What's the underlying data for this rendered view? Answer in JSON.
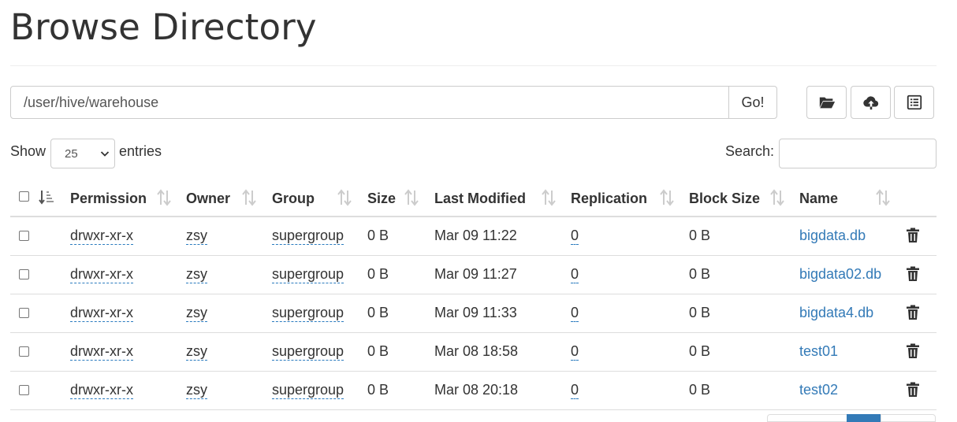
{
  "page": {
    "title": "Browse Directory"
  },
  "path_bar": {
    "value": "/user/hive/warehouse",
    "go_label": "Go!"
  },
  "toolbar": {
    "buttons": [
      {
        "icon": "folder-open-icon",
        "label": ""
      },
      {
        "icon": "cloud-upload-icon",
        "label": ""
      },
      {
        "icon": "list-alt-icon",
        "label": ""
      }
    ]
  },
  "controls": {
    "show_label": "Show",
    "entries_label": "entries",
    "page_length": "25",
    "search_label": "Search:",
    "search_value": ""
  },
  "table": {
    "columns": [
      "Permission",
      "Owner",
      "Group",
      "Size",
      "Last Modified",
      "Replication",
      "Block Size",
      "Name"
    ],
    "rows": [
      {
        "permission": "drwxr-xr-x",
        "owner": "zsy",
        "group": "supergroup",
        "size": "0 B",
        "modified": "Mar 09 11:22",
        "replication": "0",
        "block_size": "0 B",
        "name": "bigdata.db"
      },
      {
        "permission": "drwxr-xr-x",
        "owner": "zsy",
        "group": "supergroup",
        "size": "0 B",
        "modified": "Mar 09 11:27",
        "replication": "0",
        "block_size": "0 B",
        "name": "bigdata02.db"
      },
      {
        "permission": "drwxr-xr-x",
        "owner": "zsy",
        "group": "supergroup",
        "size": "0 B",
        "modified": "Mar 09 11:33",
        "replication": "0",
        "block_size": "0 B",
        "name": "bigdata4.db"
      },
      {
        "permission": "drwxr-xr-x",
        "owner": "zsy",
        "group": "supergroup",
        "size": "0 B",
        "modified": "Mar 08 18:58",
        "replication": "0",
        "block_size": "0 B",
        "name": "test01"
      },
      {
        "permission": "drwxr-xr-x",
        "owner": "zsy",
        "group": "supergroup",
        "size": "0 B",
        "modified": "Mar 08 20:18",
        "replication": "0",
        "block_size": "0 B",
        "name": "test02"
      }
    ]
  },
  "colors": {
    "link": "#337ab7",
    "border": "#dddddd",
    "text": "#333333",
    "pager_active": "#337ab7"
  }
}
